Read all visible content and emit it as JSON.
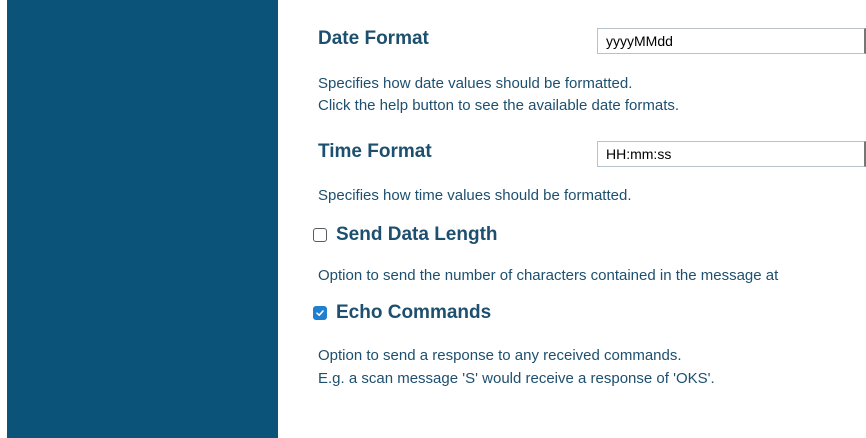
{
  "settings": {
    "date_format": {
      "label": "Date Format",
      "value": "yyyyMMdd",
      "description_line1": "Specifies how date values should be formatted.",
      "description_line2": "Click the help button to see the available date formats."
    },
    "time_format": {
      "label": "Time Format",
      "value": "HH:mm:ss",
      "description_line1": "Specifies how time values should be formatted."
    },
    "send_data_length": {
      "label": "Send Data Length",
      "checked": false,
      "description_line1": "Option to send the number of characters contained in the message at"
    },
    "echo_commands": {
      "label": "Echo Commands",
      "checked": true,
      "description_line1": "Option to send a response to any received commands.",
      "description_line2": "E.g. a scan message 'S' would receive a response of 'OKS'."
    }
  },
  "colors": {
    "sidebar": "#0c5379",
    "text": "#1d4f6f",
    "checkbox_checked": "#1f7fd1"
  }
}
